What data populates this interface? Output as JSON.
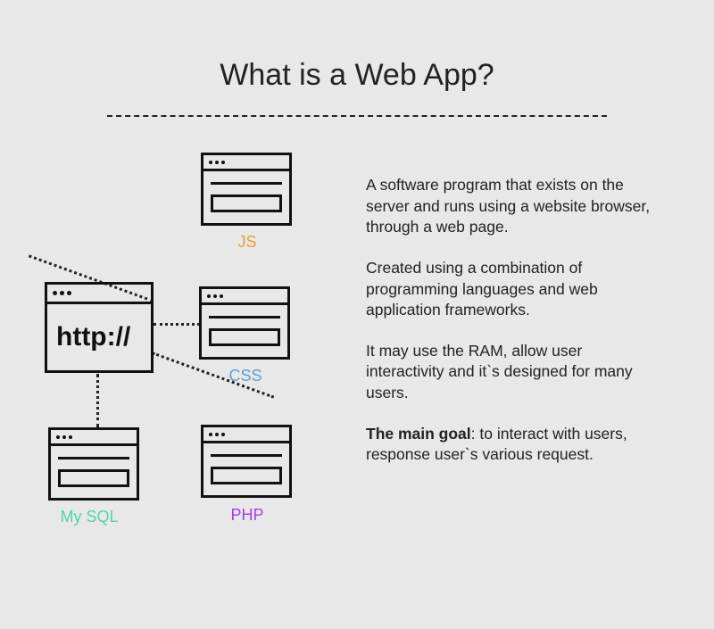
{
  "title": "What is a Web App?",
  "diagram": {
    "main_label": "http://",
    "nodes": {
      "js": {
        "label": "JS",
        "color": "#e8a035"
      },
      "css": {
        "label": "CSS",
        "color": "#5a9fd6"
      },
      "php": {
        "label": "PHP",
        "color": "#a040f0"
      },
      "mysql": {
        "label": "My SQL",
        "color": "#4fd6a8"
      }
    }
  },
  "paragraphs": {
    "p1": "A software program that exists on the server and runs using a website browser, through a web page.",
    "p2": "Created using a combination of programming languages and web application frameworks.",
    "p3": "It may use the RAM, allow user interactivity and it`s designed for many users.",
    "p4_bold": "The main goal",
    "p4_rest": ": to interact with users, response user`s various request."
  }
}
